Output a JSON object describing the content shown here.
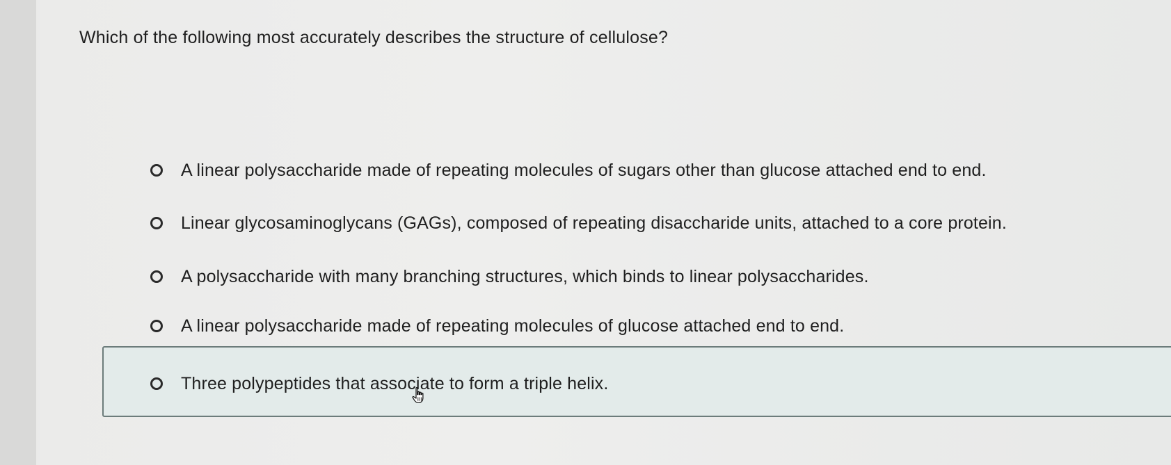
{
  "question": {
    "text": "Which of the following most accurately describes the structure of cellulose?"
  },
  "options": [
    {
      "label": "A linear polysaccharide made of repeating molecules of sugars other than glucose attached end to end.",
      "selected": false
    },
    {
      "label": "Linear glycosaminoglycans (GAGs), composed of repeating disaccharide units, attached to a core protein.",
      "selected": false
    },
    {
      "label": "A polysaccharide with many branching structures, which binds to linear polysaccharides.",
      "selected": false
    },
    {
      "label": "A linear polysaccharide made of repeating molecules of glucose attached end to end.",
      "selected": false
    },
    {
      "label": "Three polypeptides that associate to form a triple helix.",
      "selected": false,
      "hovered": true
    }
  ],
  "cursor": {
    "icon": "hand-pointer-icon"
  },
  "colors": {
    "hover_background": "#e3ebea",
    "hover_border": "#6c7c7b",
    "text": "#1f1f1f"
  }
}
